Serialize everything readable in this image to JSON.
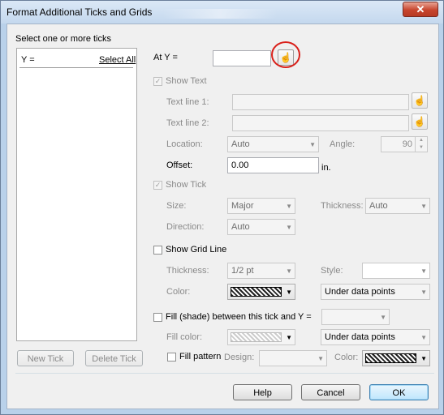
{
  "window": {
    "title": "Format Additional Ticks and Grids",
    "close_glyph": "✕"
  },
  "left_panel": {
    "prompt": "Select one or more ticks",
    "list_header": "Y =",
    "select_all": "Select All",
    "new_tick": "New Tick",
    "delete_tick": "Delete Tick"
  },
  "at_y": {
    "label": "At Y =",
    "value": ""
  },
  "text_section": {
    "show_text_label": "Show Text",
    "show_text_checked": true,
    "text_line_1_label": "Text line 1:",
    "text_line_1_value": "",
    "text_line_2_label": "Text line 2:",
    "text_line_2_value": "",
    "location_label": "Location:",
    "location_value": "Auto",
    "angle_label": "Angle:",
    "angle_value": "90",
    "offset_label": "Offset:",
    "offset_value": "0.00",
    "offset_unit": "in."
  },
  "tick_section": {
    "show_tick_label": "Show Tick",
    "show_tick_checked": true,
    "size_label": "Size:",
    "size_value": "Major",
    "thickness_label": "Thickness:",
    "thickness_value": "Auto",
    "direction_label": "Direction:",
    "direction_value": "Auto"
  },
  "grid_section": {
    "show_grid_label": "Show Grid Line",
    "show_grid_checked": false,
    "thickness_label": "Thickness:",
    "thickness_value": "1/2 pt",
    "style_label": "Style:",
    "style_value": "",
    "color_label": "Color:",
    "position_value": "Under data points"
  },
  "fill_section": {
    "fill_label": "Fill (shade) between this tick and Y =",
    "fill_checked": false,
    "fill_y_value": "",
    "fill_color_label": "Fill color:",
    "position_value": "Under data points",
    "fill_pattern_label": "Fill pattern",
    "fill_pattern_checked": false,
    "design_label": "Design:",
    "design_value": "",
    "color_label": "Color:"
  },
  "footer": {
    "help": "Help",
    "cancel": "Cancel",
    "ok": "OK"
  },
  "icons": {
    "picker_glyph": "☝",
    "check_glyph": "✓",
    "arrow_glyph": "▼",
    "spin_up": "▲",
    "spin_down": "▼"
  }
}
